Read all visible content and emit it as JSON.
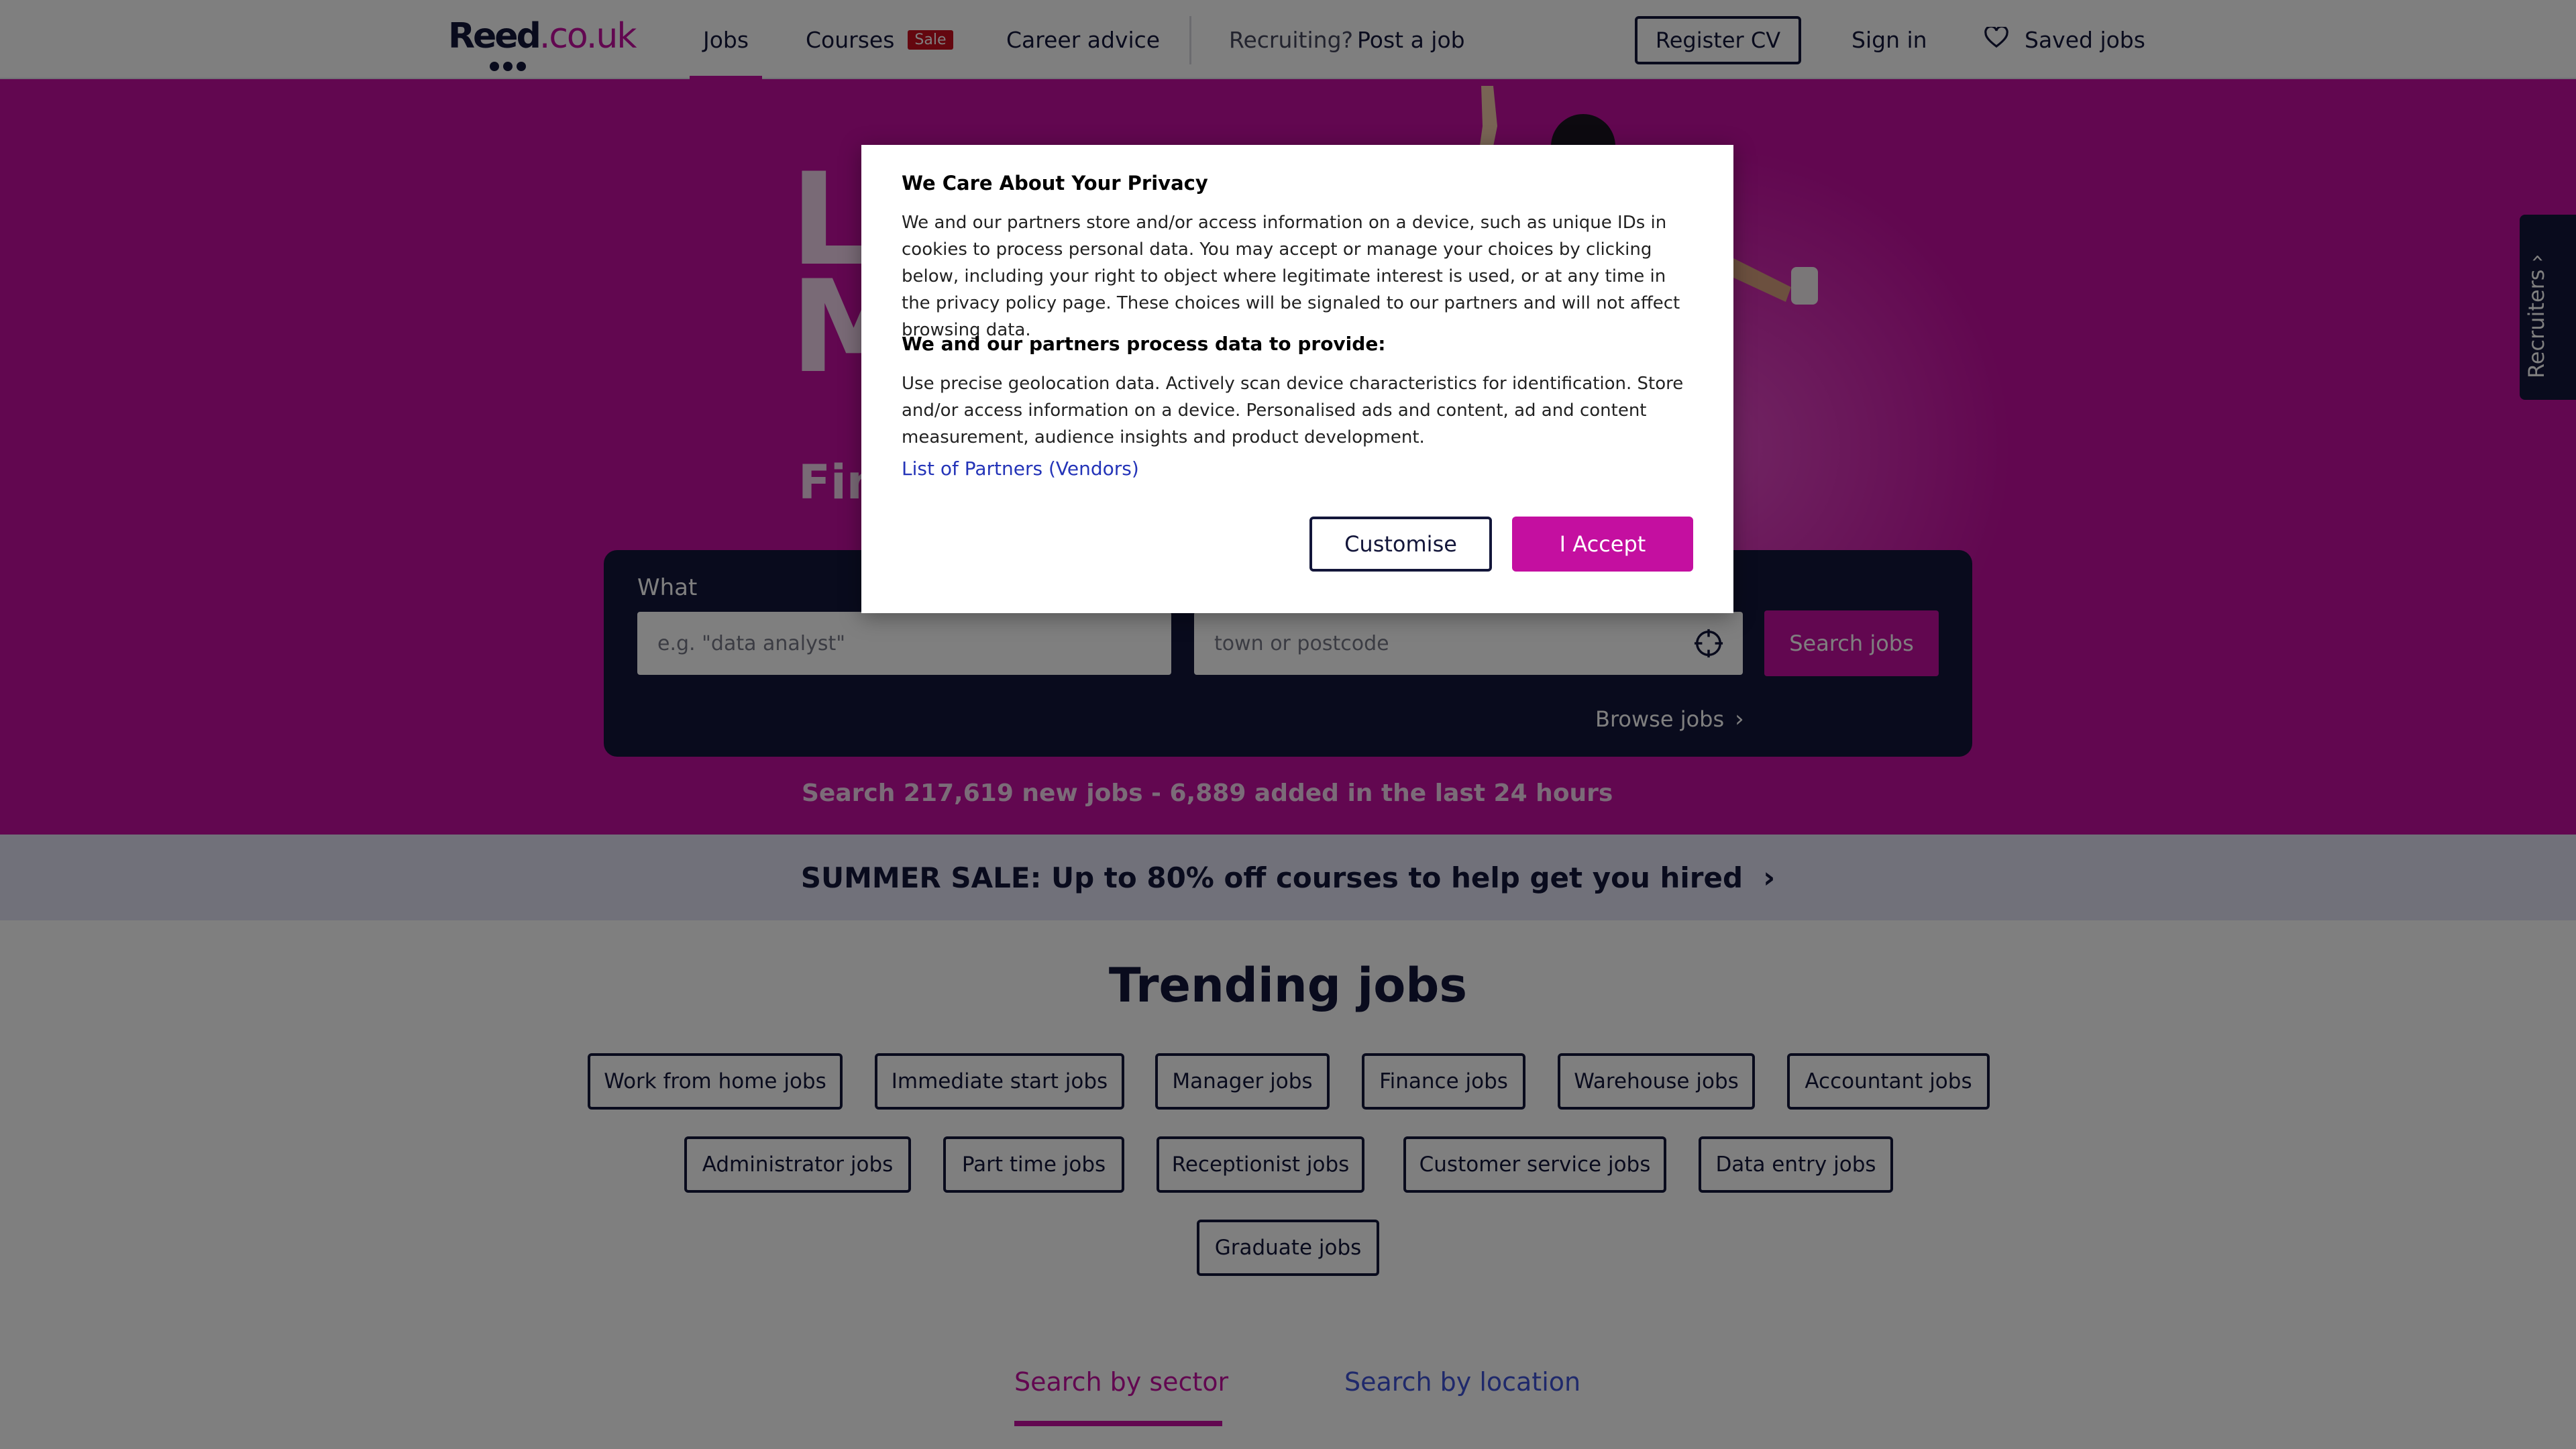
{
  "header": {
    "logo_text": "Reed",
    "logo_domain": ".co.uk",
    "nav": {
      "jobs": "Jobs",
      "courses": "Courses",
      "courses_badge": "Sale",
      "career_advice": "Career advice",
      "recruiting_prefix": "Recruiting?",
      "post_job": "Post a job"
    },
    "register_cv": "Register CV",
    "sign_in": "Sign in",
    "saved_jobs": "Saved jobs",
    "saved_icon": "heart-icon"
  },
  "hero": {
    "heading_line1": "L",
    "heading_line2": "M",
    "subheading": "Fin",
    "search": {
      "what_label": "What",
      "what_placeholder": "e.g. \"data analyst\"",
      "where_placeholder": "town or postcode",
      "location_icon": "crosshair-icon",
      "search_button": "Search jobs",
      "browse_link": "Browse jobs"
    },
    "stats": "Search 217,619 new jobs - 6,889 added in the last 24 hours"
  },
  "sale_banner": {
    "text": "SUMMER SALE: Up to 80% off courses to help get you hired"
  },
  "trending": {
    "title": "Trending jobs",
    "chips": [
      "Work from home jobs",
      "Immediate start jobs",
      "Manager jobs",
      "Finance jobs",
      "Warehouse jobs",
      "Accountant jobs",
      "Administrator jobs",
      "Part time jobs",
      "Receptionist jobs",
      "Customer service jobs",
      "Data entry jobs",
      "Graduate jobs"
    ]
  },
  "tabs": {
    "sector": "Search by sector",
    "location": "Search by location"
  },
  "recruiters_tab": "Recruiters",
  "privacy_dialog": {
    "title": "We Care About Your Privacy",
    "body": "We and our partners store and/or access information on a device, such as unique IDs in cookies to process personal data. You may accept or manage your choices by clicking below, including your right to object where legitimate interest is used, or at any time in the privacy policy page. These choices will be signaled to our partners and will not affect browsing data.",
    "purposes_title": "We and our partners process data to provide:",
    "purposes": "Use precise geolocation data. Actively scan device characteristics for identification. Store and/or access information on a device. Personalised ads and content, ad and content measurement, audience insights and product development.",
    "vendors_link": "List of Partners (Vendors)",
    "customise_button": "Customise",
    "accept_button": "I Accept"
  },
  "colors": {
    "brand_magenta": "#c40fa0",
    "navy": "#13163a",
    "sale_red": "#c80e1e",
    "banner_lavender": "#e2e3f4",
    "link_blue": "#3f53d6"
  }
}
